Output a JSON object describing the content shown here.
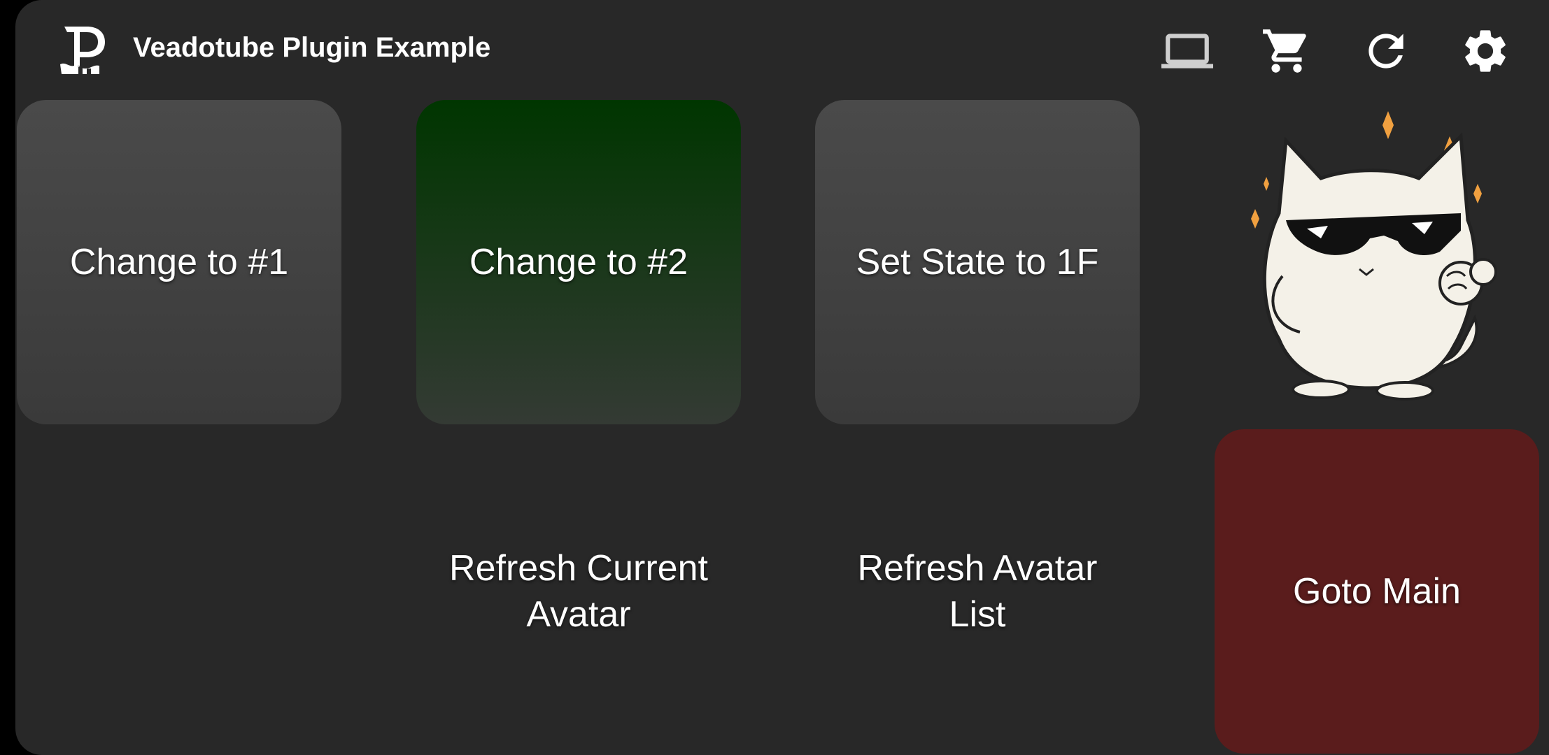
{
  "header": {
    "title": "Veadotube Plugin Example",
    "icons": [
      "app-logo",
      "computer-icon",
      "cart-icon",
      "refresh-icon",
      "settings-icon"
    ]
  },
  "tiles": [
    {
      "label": "Change to #1",
      "style": "grey"
    },
    {
      "label": "Change to #2",
      "style": "green"
    },
    {
      "label": "Set State to 1F",
      "style": "grey"
    },
    {
      "label": "",
      "style": "image",
      "image": "cool-cat-sticker"
    },
    {
      "label": "",
      "style": "empty"
    },
    {
      "label": "Refresh Current Avatar",
      "style": "plain"
    },
    {
      "label": "Refresh Avatar List",
      "style": "plain"
    },
    {
      "label": "Goto Main",
      "style": "red"
    }
  ],
  "colors": {
    "background": "#282828",
    "tile_grey": "#444444",
    "tile_green": "#003600",
    "tile_red": "#5a1c1c",
    "text": "#ffffff",
    "sparkle": "#f0a040"
  }
}
